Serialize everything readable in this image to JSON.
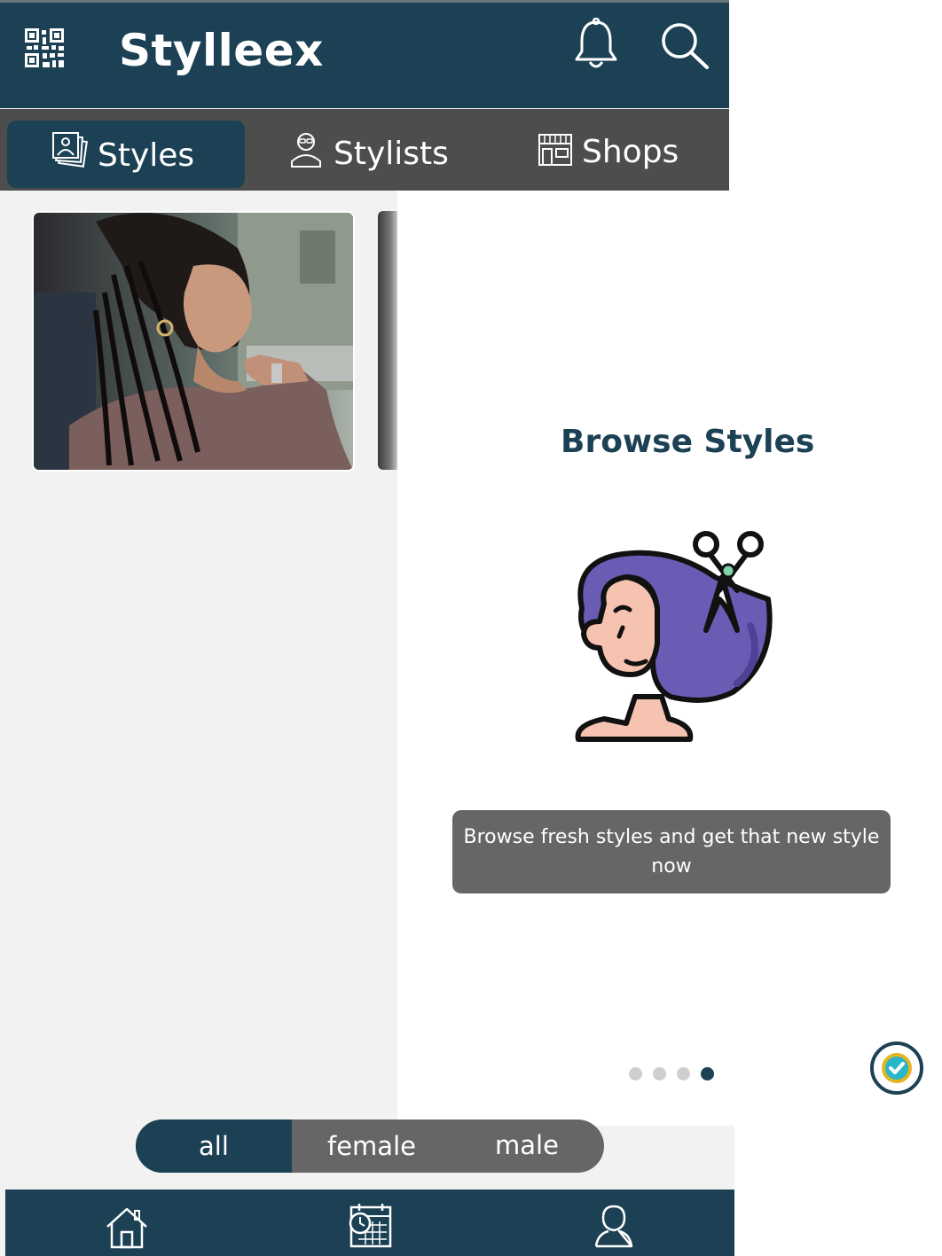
{
  "app": {
    "title": "Stylleex",
    "header_icons": [
      "qr-code-icon",
      "bell-icon",
      "search-icon"
    ]
  },
  "tabs": [
    {
      "label": "Styles",
      "icon": "photo-stack-icon",
      "active": true
    },
    {
      "label": "Stylists",
      "icon": "stylist-person-icon",
      "active": false
    },
    {
      "label": "Shops",
      "icon": "storefront-icon",
      "active": false
    }
  ],
  "onboarding": {
    "title": "Browse Styles",
    "illustration": "woman-with-scissors-hair-icon",
    "description": "Browse fresh styles and get that new style now",
    "page_count": 4,
    "current_page": 4
  },
  "gender_filter": {
    "options": [
      "all",
      "female",
      "male"
    ],
    "selected": "all"
  },
  "bottom_nav": {
    "items": [
      "home-icon",
      "calendar-clock-icon",
      "profile-icon"
    ]
  },
  "colors": {
    "primary": "#1c4155",
    "tab_bar": "#4d4d4d",
    "tip_box": "#666666",
    "background": "#f2f2f2",
    "illustration_hair": "#6a5cb5"
  }
}
